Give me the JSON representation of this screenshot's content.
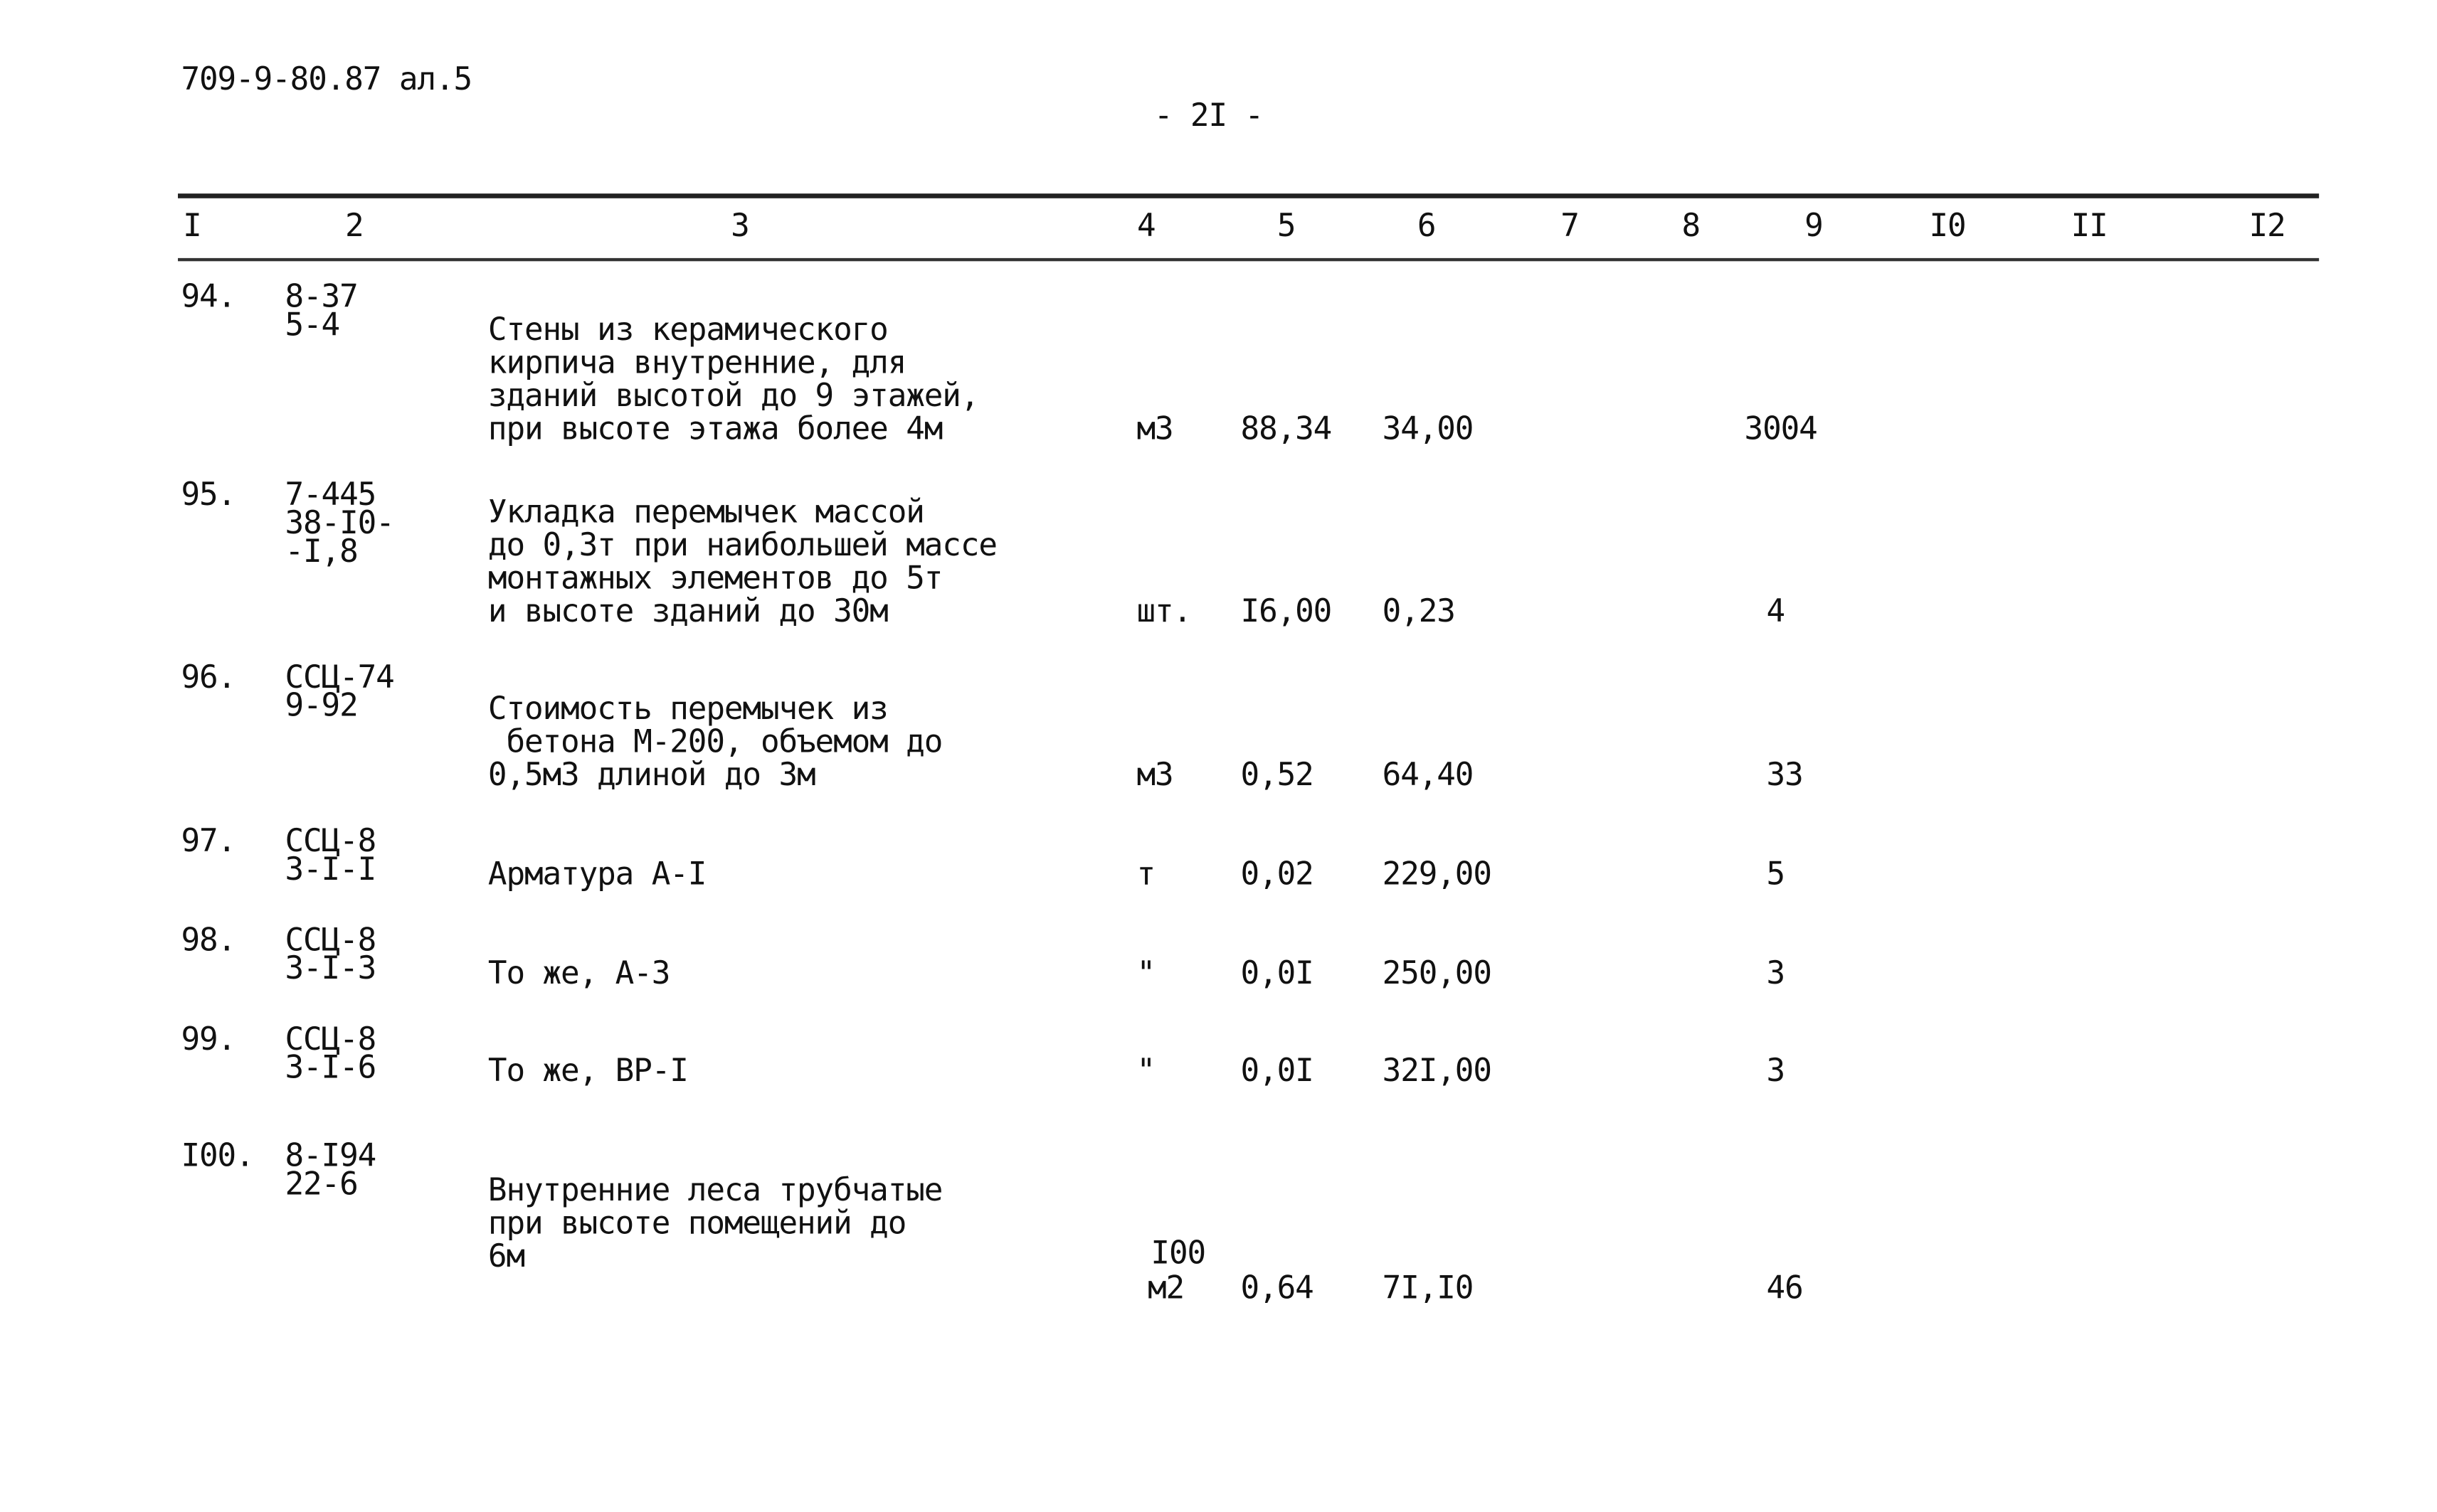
{
  "document": {
    "code": "709-9-80.87 ал.5",
    "page_number": "- 2I -"
  },
  "table": {
    "headers": [
      "I",
      "2",
      "3",
      "4",
      "5",
      "6",
      "7",
      "8",
      "9",
      "I0",
      "II",
      "I2"
    ],
    "rows": [
      {
        "num": "94.",
        "code": [
          "8-37",
          "5-4"
        ],
        "desc": [
          "Стены из керамического",
          "кирпича внутренние, для",
          "зданий высотой до 9 этажей,",
          "при высоте этажа более 4м"
        ],
        "unit": [
          "м3"
        ],
        "qty": "88,34",
        "price": "34,00",
        "total": "3004"
      },
      {
        "num": "95.",
        "code": [
          "7-445",
          "38-I0-",
          "-I,8"
        ],
        "desc": [
          "Укладка перемычек массой",
          "до 0,3т при наибольшей массе",
          "монтажных элементов до 5т",
          "и высоте зданий до 30м"
        ],
        "unit": [
          "шт."
        ],
        "qty": "I6,00",
        "price": "0,23",
        "total": "4"
      },
      {
        "num": "96.",
        "code": [
          "ССЦ-74",
          "9-92"
        ],
        "desc": [
          "Стоимость перемычек из",
          " бетона М-200, объемом до",
          "0,5м3 длиной до 3м"
        ],
        "unit": [
          "м3"
        ],
        "qty": "0,52",
        "price": "64,40",
        "total": "33"
      },
      {
        "num": "97.",
        "code": [
          "ССЦ-8",
          "3-I-I"
        ],
        "desc": [
          "Арматура А-I"
        ],
        "unit": [
          "т"
        ],
        "qty": "0,02",
        "price": "229,00",
        "total": "5"
      },
      {
        "num": "98.",
        "code": [
          "ССЦ-8",
          "3-I-3"
        ],
        "desc": [
          "То же, А-3"
        ],
        "unit": [
          "\""
        ],
        "qty": "0,0I",
        "price": "250,00",
        "total": "3"
      },
      {
        "num": "99.",
        "code": [
          "ССЦ-8",
          "3-I-6"
        ],
        "desc": [
          "То же, ВР-I"
        ],
        "unit": [
          "\""
        ],
        "qty": "0,0I",
        "price": "32I,00",
        "total": "3"
      },
      {
        "num": "I00.",
        "code": [
          "8-I94",
          "22-6"
        ],
        "desc": [
          "Внутренние леса трубчатые",
          "при высоте помещений до",
          "6м"
        ],
        "unit": [
          "I00",
          "м2"
        ],
        "qty": "0,64",
        "price": "7I,I0",
        "total": "46"
      }
    ]
  }
}
